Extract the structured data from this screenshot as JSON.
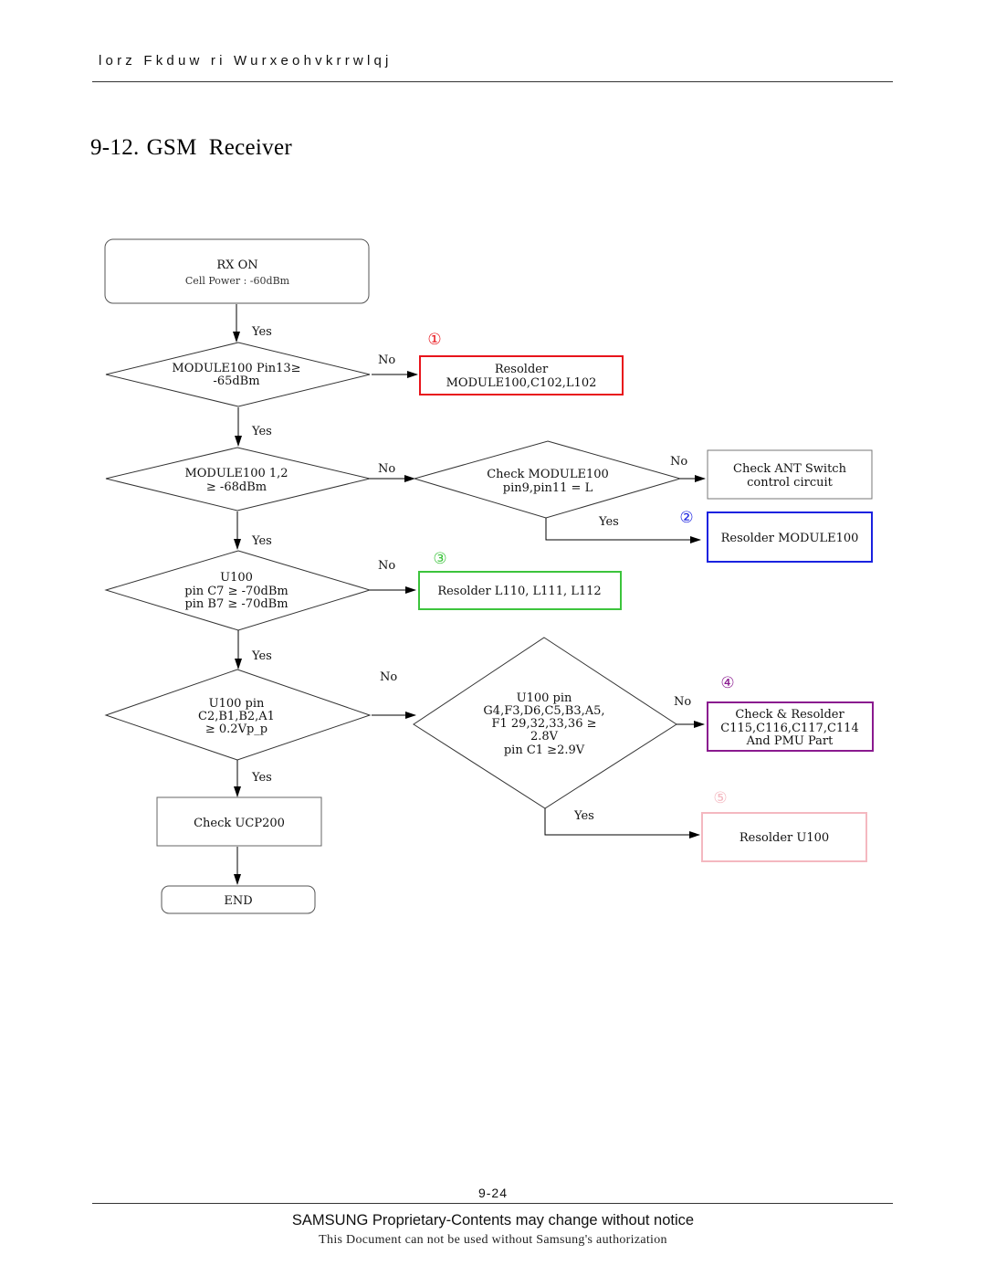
{
  "header": {
    "running_title": "lorz Fkduw ri Wurxeohvkrrwlqj"
  },
  "section": {
    "number": "9-12.",
    "title": "GSM  Receiver"
  },
  "flowchart": {
    "start": {
      "title": "RX ON",
      "subtitle": "Cell Power : -60dBm"
    },
    "decision1": {
      "lines": [
        "MODULE100 Pin13≥",
        "-65dBm"
      ]
    },
    "decision2": {
      "lines": [
        "MODULE100 1,2",
        "≥ -68dBm"
      ]
    },
    "decision2b": {
      "lines": [
        "Check MODULE100",
        "pin9,pin11 = L"
      ]
    },
    "decision3": {
      "lines": [
        "U100",
        "pin C7 ≥ -70dBm",
        "pin B7 ≥ -70dBm"
      ]
    },
    "decision4": {
      "lines": [
        "U100 pin",
        "C2,B1,B2,A1",
        "≥ 0.2Vp_p"
      ]
    },
    "decision4b": {
      "lines": [
        "U100 pin",
        "G4,F3,D6,C5,B3,A5,",
        "F1 29,32,33,36 ≥",
        "2.8V",
        "pin C1 ≥2.9V"
      ]
    },
    "action_ant": {
      "lines": [
        "Check ANT Switch",
        "control circuit"
      ]
    },
    "action1": {
      "marker": "①",
      "color": "#e8141b",
      "lines": [
        "Resolder",
        "MODULE100,C102,L102"
      ]
    },
    "action2": {
      "marker": "②",
      "color": "#1a22e0",
      "lines": [
        "Resolder MODULE100"
      ]
    },
    "action3": {
      "marker": "③",
      "color": "#3cc43c",
      "lines": [
        "Resolder L110, L111, L112"
      ]
    },
    "action4": {
      "marker": "④",
      "color": "#8a1a8f",
      "lines": [
        "Check & Resolder",
        "C115,C116,C117,C114",
        "And PMU Part"
      ]
    },
    "action5": {
      "marker": "⑤",
      "color": "#f4b8c0",
      "lines": [
        "Resolder U100"
      ]
    },
    "check_ucp": {
      "lines": [
        "Check UCP200"
      ]
    },
    "end": {
      "label": "END"
    },
    "labels": {
      "yes": "Yes",
      "no": "No"
    }
  },
  "footer": {
    "page_number": "9-24",
    "notice": "SAMSUNG Proprietary-Contents may change without notice",
    "authorization": "This Document can not be used without Samsung's authorization"
  }
}
